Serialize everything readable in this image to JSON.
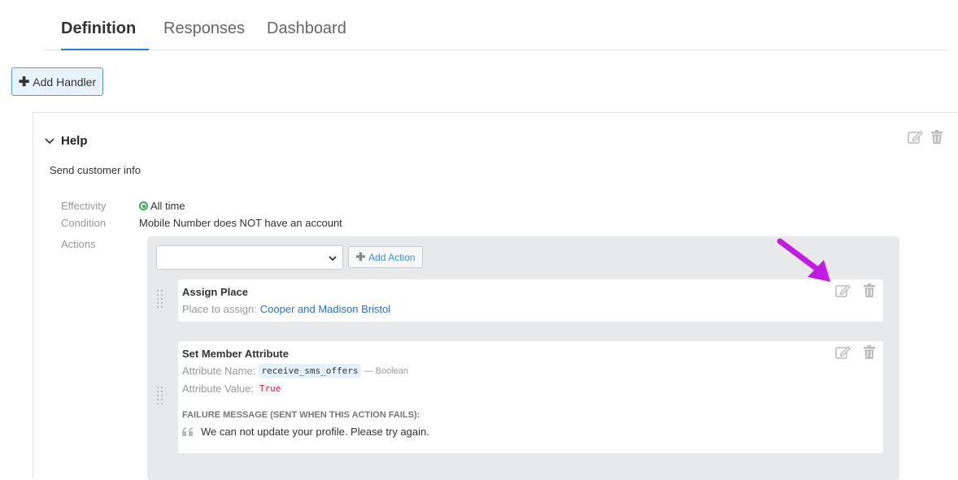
{
  "tabs": [
    {
      "label": "Definition",
      "active": true
    },
    {
      "label": "Responses",
      "active": false
    },
    {
      "label": "Dashboard",
      "active": false
    }
  ],
  "toolbar": {
    "add_handler_label": "Add Handler"
  },
  "handler": {
    "title": "Help",
    "description": "Send customer info",
    "properties": {
      "effectivity_label": "Effectivity",
      "effectivity_value": "All time",
      "condition_label": "Condition",
      "condition_value": "Mobile Number does NOT have an account",
      "actions_label": "Actions"
    }
  },
  "actions": {
    "select_value": "",
    "add_action_label": "Add Action",
    "items": [
      {
        "title": "Assign Place",
        "place_label": "Place to assign:",
        "place_value": "Cooper and Madison Bristol"
      },
      {
        "title": "Set Member Attribute",
        "attr_name_label": "Attribute Name:",
        "attr_name_value": "receive_sms_offers",
        "attr_type": "— Boolean",
        "attr_value_label": "Attribute Value:",
        "attr_value_value": "True",
        "failure_label": "FAILURE MESSAGE (SENT WHEN THIS ACTION FAILS):",
        "failure_message": "We can not update your profile. Please try again."
      }
    ]
  },
  "colors": {
    "accent": "#2b7bd6",
    "arrow": "#c31be6",
    "success": "#3aaa5c"
  }
}
